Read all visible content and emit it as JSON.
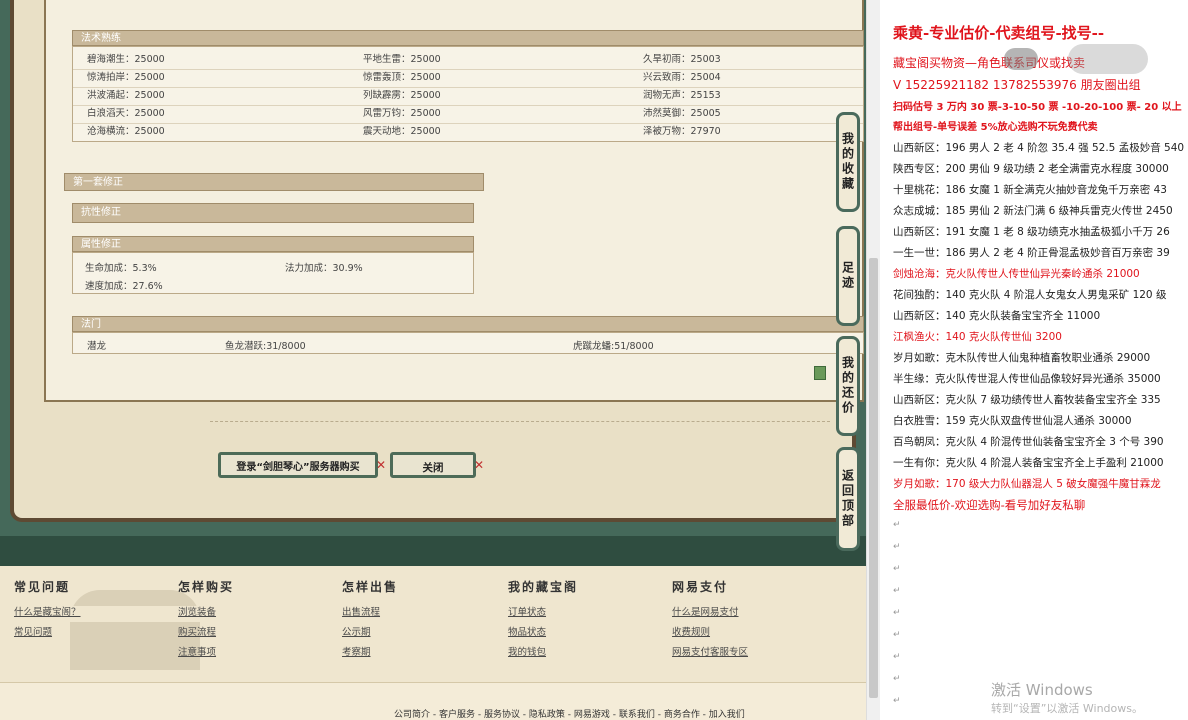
{
  "fashu": {
    "title": "法术熟练",
    "rows": [
      [
        "碧海潮生：25000",
        "平地生雷：25000",
        "久旱初雨：25003"
      ],
      [
        "惊涛拍岸：25000",
        "惊雷轰顶：25000",
        "兴云致雨：25004"
      ],
      [
        "洪波涌起：25000",
        "列缺霹雳：25000",
        "润物无声：25153"
      ],
      [
        "白浪滔天：25000",
        "风雷万钧：25000",
        "沛然莫御：25005"
      ],
      [
        "沧海横流：25000",
        "震天动地：25000",
        "泽被万物：27970"
      ]
    ]
  },
  "xiuzheng": {
    "title": "第一套修正",
    "kangxing": "抗性修正",
    "shuxing": "属性修正",
    "shengming": "生命加成：5.3%",
    "fali": "法力加成：30.9%",
    "sudu": "速度加成：27.6%"
  },
  "fabao": {
    "title": "法门",
    "c1": "潜龙",
    "c2": "鱼龙潜跃:31/8000",
    "c3": "虎蹴龙蟠:51/8000"
  },
  "buttons": {
    "login": "登录“剑胆琴心”服务器购买",
    "close": "关闭"
  },
  "side_tabs": {
    "favorites": "我的收藏",
    "footprint": "足迹",
    "bargain": "我的还价",
    "top": "返回顶部"
  },
  "footer": {
    "cols": [
      {
        "title": "常见问题",
        "links": [
          "什么是藏宝阁？",
          "常见问题"
        ]
      },
      {
        "title": "怎样购买",
        "links": [
          "浏览装备",
          "购买流程",
          "注意事项"
        ]
      },
      {
        "title": "怎样出售",
        "links": [
          "出售流程",
          "公示期",
          "考察期"
        ]
      },
      {
        "title": "我的藏宝阁",
        "links": [
          "订单状态",
          "物品状态",
          "我的钱包"
        ]
      },
      {
        "title": "网易支付",
        "links": [
          "什么是网易支付",
          "收费规则",
          "网易支付客服专区"
        ]
      }
    ],
    "bottom_links": "公司简介 - 客户服务 - 服务协议 - 隐私政策 - 网易游戏 - 联系我们 - 商务合作 - 加入我们"
  },
  "doc": {
    "line0": "乘黄-专业估价-代卖组号-找号--",
    "line1": "藏宝阁买物资—角色联系司仪或找卖",
    "line2": "V 15225921182   13782553976 朋友圈出组",
    "line3": "扫码估号 3 万内 30 票-3-10-50 票 -10-20-100 票- 20 以上",
    "line4": "帮出组号-单号误差 5%放心选购不玩免费代卖",
    "items": [
      {
        "t": "山西新区：196 男人 2 老 4 阶忽 35.4 强 52.5 孟极妙音 540",
        "red": false
      },
      {
        "t": "陕西专区：200 男仙 9 级功绩 2 老全满雷克水程度 30000",
        "red": false
      },
      {
        "t": "十里桃花：186 女魔 1 新全满克火抽妙音龙兔千万亲密 43",
        "red": false
      },
      {
        "t": "众志成城：185 男仙 2 新法门满 6 级神兵雷克火传世 2450",
        "red": false
      },
      {
        "t": "山西新区：191 女魔 1 老 8 级功绩克水抽孟极狐小千万 26",
        "red": false
      },
      {
        "t": "一生一世：186 男人 2 老 4 阶正骨混孟极妙音百万亲密 39",
        "red": false
      },
      {
        "t": "剑烛沧海：克火队传世人传世仙异光秦岭通杀 21000",
        "red": true
      },
      {
        "t": "花间独酌：140 克火队 4 阶混人女鬼女人男鬼采矿 120 级",
        "red": false
      },
      {
        "t": "山西新区：140 克火队装备宝宝齐全 11000",
        "red": false
      },
      {
        "t": "江枫渔火：140 克火队传世仙 3200",
        "red": true
      },
      {
        "t": "岁月如歌：克木队传世人仙鬼种植畜牧职业通杀 29000",
        "red": false
      },
      {
        "t": "半生缘：克火队传世混人传世仙品像较好异光通杀 35000",
        "red": false
      },
      {
        "t": "山西新区：克火队 7 级功绩传世人畜牧装备宝宝齐全 335",
        "red": false
      },
      {
        "t": "白衣胜雪：159 克火队双盘传世仙混人通杀 30000",
        "red": false
      },
      {
        "t": "百鸟朝凤：克火队 4 阶混传世仙装备宝宝齐全 3 个号 390",
        "red": false
      },
      {
        "t": "一生有你：克火队 4 阶混人装备宝宝齐全上手盈利 21000",
        "red": false
      },
      {
        "t": "岁月如歌：170 级大力队仙器混人 5 破女魔强牛魔甘霖龙",
        "red": true
      },
      {
        "t": "全服最低价-欢迎选购-看号加好友私聊",
        "red": true
      }
    ],
    "watermark": "激活 Windows",
    "watermark_sub": "转到“设置”以激活 Windows。"
  }
}
